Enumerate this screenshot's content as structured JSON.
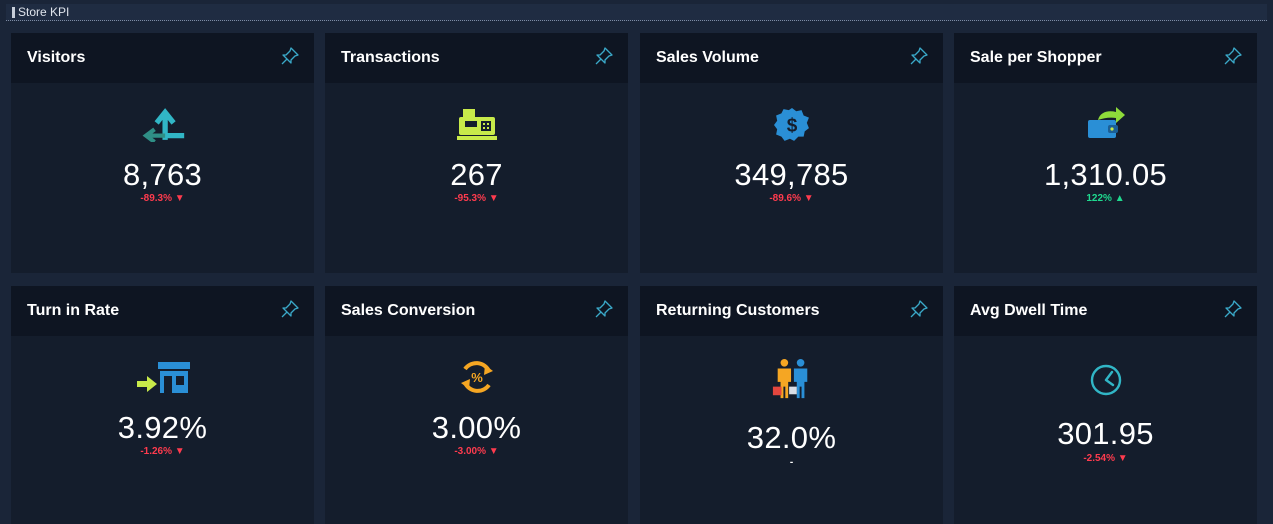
{
  "section": {
    "title": "Store KPI"
  },
  "colors": {
    "accent": "#3aa9c9",
    "negative": "#ff3b4e",
    "positive": "#1fd98f"
  },
  "cards": [
    {
      "label": "Visitors",
      "value": "8,763",
      "change": "-89.3%",
      "trend": "down",
      "icon": "visitors-arrows-icon"
    },
    {
      "label": "Transactions",
      "value": "267",
      "change": "-95.3%",
      "trend": "down",
      "icon": "cash-register-icon"
    },
    {
      "label": "Sales Volume",
      "value": "349,785",
      "change": "-89.6%",
      "trend": "down",
      "icon": "dollar-badge-icon"
    },
    {
      "label": "Sale per Shopper",
      "value": "1,310.05",
      "change": "122%",
      "trend": "up",
      "icon": "wallet-share-icon"
    },
    {
      "label": "Turn in Rate",
      "value": "3.92%",
      "change": "-1.26%",
      "trend": "down",
      "icon": "store-entry-icon"
    },
    {
      "label": "Sales Conversion",
      "value": "3.00%",
      "change": "-3.00%",
      "trend": "down",
      "icon": "percent-cycle-icon"
    },
    {
      "label": "Returning Customers",
      "value": "32.0%",
      "change": "-",
      "trend": "none",
      "icon": "shoppers-icon"
    },
    {
      "label": "Avg Dwell Time",
      "value": "301.95",
      "change": "-2.54%",
      "trend": "down",
      "icon": "clock-icon"
    }
  ]
}
